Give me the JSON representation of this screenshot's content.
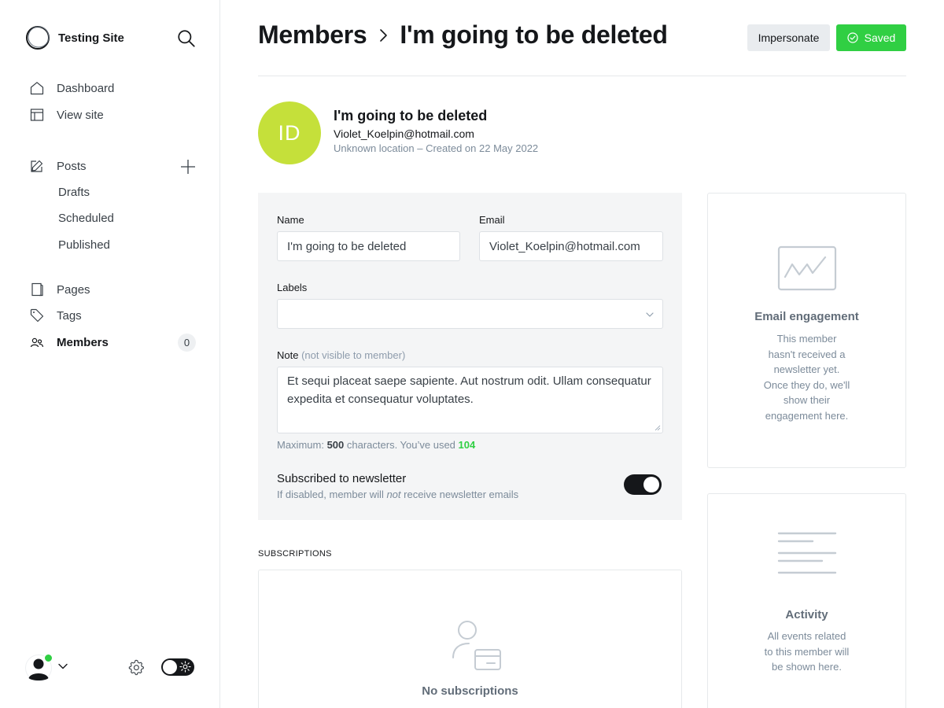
{
  "site": {
    "name": "Testing Site"
  },
  "nav": {
    "dashboard": "Dashboard",
    "view_site": "View site",
    "posts": "Posts",
    "drafts": "Drafts",
    "scheduled": "Scheduled",
    "published": "Published",
    "pages": "Pages",
    "tags": "Tags",
    "members": "Members",
    "members_count": "0"
  },
  "header": {
    "breadcrumb_parent": "Members",
    "title": "I'm going to be deleted",
    "impersonate_label": "Impersonate",
    "saved_label": "Saved"
  },
  "member": {
    "initials": "ID",
    "name": "I'm going to be deleted",
    "email": "Violet_Koelpin@hotmail.com",
    "meta": "Unknown location – Created on 22 May 2022",
    "avatar_color": "#c5e03a"
  },
  "form": {
    "name_label": "Name",
    "name_value": "I'm going to be deleted",
    "email_label": "Email",
    "email_value": "Violet_Koelpin@hotmail.com",
    "labels_label": "Labels",
    "labels_value": "",
    "note_label": "Note",
    "note_hint": "(not visible to member)",
    "note_value": "Et sequi placeat saepe sapiente. Aut nostrum odit. Ullam consequatur expedita et consequatur voluptates.",
    "limit_prefix": "Maximum: ",
    "limit_max": "500",
    "limit_mid": " characters. You’ve used ",
    "limit_used": "104",
    "newsletter_title": "Subscribed to newsletter",
    "newsletter_desc_prefix": "If disabled, member will ",
    "newsletter_desc_em": "not",
    "newsletter_desc_suffix": " receive newsletter emails",
    "newsletter_on": true
  },
  "subscriptions": {
    "section_label": "SUBSCRIPTIONS",
    "empty_title": "No subscriptions"
  },
  "engagement": {
    "title": "Email engagement",
    "lines": [
      "This member",
      "hasn't received a",
      "newsletter yet.",
      "Once they do, we'll",
      "show their",
      "engagement here."
    ]
  },
  "activity": {
    "title": "Activity",
    "lines": [
      "All events related",
      "to this member will",
      "be shown here."
    ]
  },
  "colors": {
    "accent": "#30cf43",
    "dark": "#15171a",
    "panel": "#f4f5f6"
  },
  "icons": {
    "search": "search-icon",
    "dashboard": "home-icon",
    "view_site": "layout-icon",
    "posts": "pencil-icon",
    "pages": "page-icon",
    "tags": "tag-icon",
    "members": "users-icon",
    "settings": "gear-icon",
    "theme": "sun-icon"
  }
}
